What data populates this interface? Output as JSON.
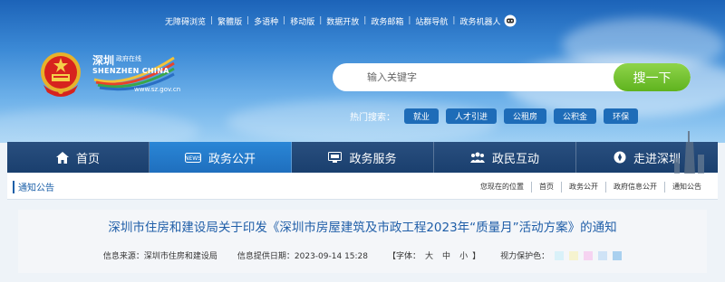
{
  "top_links": [
    "无障碍浏览",
    "繁體版",
    "多语种",
    "移动版",
    "数据开放",
    "政务邮箱",
    "站群导航",
    "政务机器人"
  ],
  "logo": {
    "cn": "深圳",
    "cn_small": "政府在线",
    "en": "SHENZHEN CHINA",
    "url": "www.sz.gov.cn"
  },
  "search": {
    "placeholder": "输入关键字",
    "button": "搜一下"
  },
  "hot_search": {
    "label": "热门搜索：",
    "tags": [
      "就业",
      "人才引进",
      "公租房",
      "公积金",
      "环保"
    ]
  },
  "nav": [
    {
      "label": "首页",
      "icon": "home-icon"
    },
    {
      "label": "政务公开",
      "icon": "news-icon",
      "active": true
    },
    {
      "label": "政务服务",
      "icon": "monitor-icon"
    },
    {
      "label": "政民互动",
      "icon": "people-icon"
    },
    {
      "label": "走进深圳",
      "icon": "compass-icon"
    }
  ],
  "breadcrumb": {
    "section": "通知公告",
    "location_label": "您现在的位置",
    "items": [
      "首页",
      "政务公开",
      "政府信息公开",
      "通知公告"
    ]
  },
  "article": {
    "title": "深圳市住房和建设局关于印发《深圳市房屋建筑及市政工程2023年“质量月”活动方案》的通知",
    "source": "信息来源：深圳市住房和建设局",
    "date": "信息提供日期：2023-09-14 15:28",
    "font_label": "【字体：",
    "font_sizes": [
      "大",
      "中",
      "小"
    ],
    "font_close": "】",
    "vision_label": "视力保护色：",
    "vision_colors": [
      "#d9f1f9",
      "#f6f3cf",
      "#f6d3f1",
      "#cfe3f6",
      "#a9d0ef"
    ]
  },
  "colors": {
    "nav_bg": "#1a3f6e",
    "nav_active": "#1f6fbe",
    "search_button": "#6cbd2a",
    "title_blue": "#1f5ea8"
  }
}
